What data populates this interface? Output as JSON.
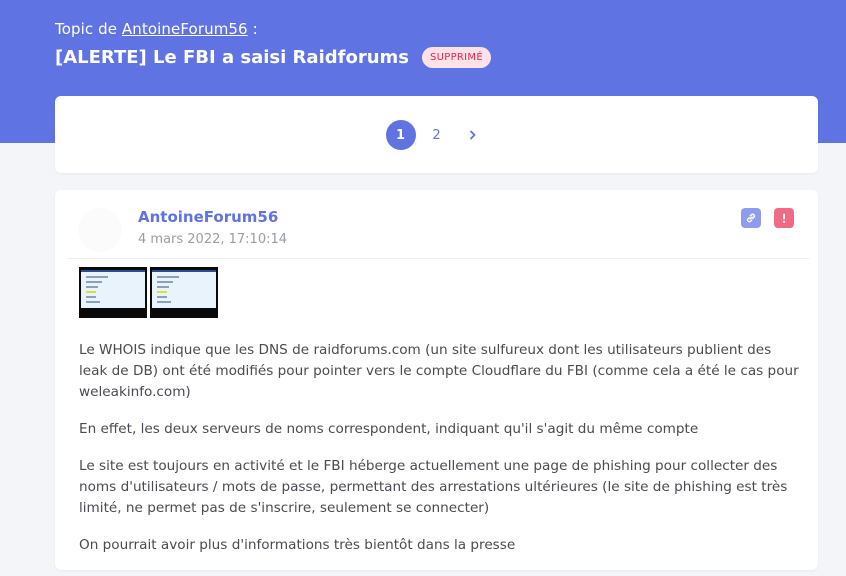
{
  "header": {
    "topic_prefix": "Topic de",
    "topic_author": "AntoineForum56",
    "topic_suffix": ":",
    "title": "[ALERTE] Le FBI a saisi Raidforums",
    "badge": "SUPPRIMÉ"
  },
  "pagination": {
    "pages": [
      "1",
      "2"
    ],
    "current": "1",
    "next_icon": "chevron-right-icon"
  },
  "post": {
    "author": "AntoineForum56",
    "date": "4 mars 2022, 17:10:14",
    "actions": [
      "link-icon",
      "report-icon"
    ],
    "paragraphs": [
      "Le WHOIS indique que les DNS de raidforums.com (un site sulfureux dont les utilisateurs publient des leak de DB) ont été modifiés pour pointer vers le compte Cloudflare du FBI (comme cela a été le cas pour weleakinfo.com)",
      "En effet, les deux serveurs de noms correspondent, indiquant qu'il s'agit du même compte",
      "Le site est toujours en activité et le FBI héberge actuellement une page de phishing pour collecter des noms d'utilisateurs / mots de passe, permettant des arrestations ultérieures (le site de phishing est très limité, ne permet pas de s'inscrire, seulement se connecter)",
      "On pourrait avoir plus d'informations très bientôt dans la presse"
    ]
  },
  "colors": {
    "accent": "#5f73e2",
    "badge_bg": "#fde2e7",
    "badge_text": "#e2254f",
    "report": "#f06a85"
  }
}
